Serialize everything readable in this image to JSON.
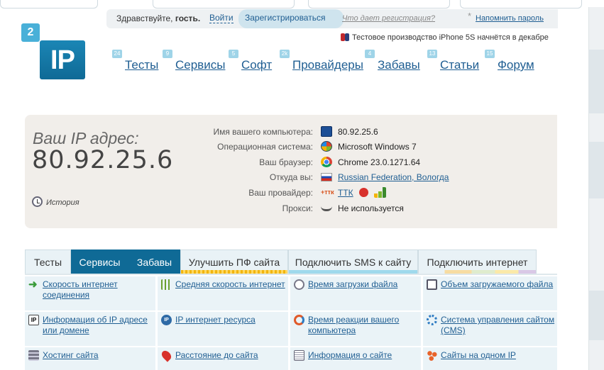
{
  "auth": {
    "hello_prefix": "Здравствуйте,",
    "hello_user": "гость.",
    "login": "Войти",
    "register": "Зарегистрироваться",
    "what_register": "Что дает регистрация?",
    "star": "*",
    "remind_password": "Напомнить пароль"
  },
  "news": {
    "text": "Тестовое производство iPhone 5S начнётся в декабре"
  },
  "logo": {
    "small": "2",
    "main": "IP"
  },
  "nav": [
    {
      "count": "24",
      "label": "Тесты"
    },
    {
      "count": "9",
      "label": "Сервисы"
    },
    {
      "count": "5",
      "label": "Софт"
    },
    {
      "count": "2k",
      "label": "Провайдеры"
    },
    {
      "count": "4",
      "label": "Забавы"
    },
    {
      "count": "13",
      "label": "Статьи"
    },
    {
      "count": "15",
      "label": "Форум"
    }
  ],
  "ip": {
    "heading": "Ваш IP адрес:",
    "value": "80.92.25.6",
    "history": "История"
  },
  "info": [
    {
      "label": "Имя вашего компьютера:",
      "icon": "computer-icon",
      "value": "80.92.25.6",
      "link": false
    },
    {
      "label": "Операционная система:",
      "icon": "windows-icon",
      "value": "Microsoft Windows 7",
      "link": false
    },
    {
      "label": "Ваш браузер:",
      "icon": "chrome-icon",
      "value": "Chrome 23.0.1271.64",
      "link": false
    },
    {
      "label": "Откуда вы:",
      "icon": "russia-flag-icon",
      "value": "Russian Federation, Вологда",
      "link": true
    },
    {
      "label": "Ваш провайдер:",
      "icon": "ttk-logo-icon",
      "value": "ТТК",
      "link": true
    },
    {
      "label": "Прокси:",
      "icon": "glasses-icon",
      "value": "Не используется",
      "link": false
    }
  ],
  "tabs": [
    {
      "label": "Тесты"
    },
    {
      "label": "Сервисы"
    },
    {
      "label": "Забавы"
    },
    {
      "label": "Улучшить ПФ сайта"
    },
    {
      "label": "Подключить SMS к сайту"
    },
    {
      "label": "Подключить интернет"
    }
  ],
  "services": [
    {
      "label": "Скорость интернет соединения",
      "icon": "speed-arrow-icon"
    },
    {
      "label": "Средняя скорость интернет",
      "icon": "bars-icon"
    },
    {
      "label": "Время загрузки файла",
      "icon": "clock-icon"
    },
    {
      "label": "Объем загружаемого файла",
      "icon": "file-size-icon"
    },
    {
      "label": "Информация об IP адресе или домене",
      "icon": "ip-box-icon",
      "icon_text": "IP"
    },
    {
      "label": "IP интернет ресурса",
      "icon": "ip-circle-icon",
      "icon_text": "IP"
    },
    {
      "label": "Время реакции вашего компьютера",
      "icon": "refresh-icon"
    },
    {
      "label": "Система управления сайтом (CMS)",
      "icon": "gears-icon"
    },
    {
      "label": "Хостинг сайта",
      "icon": "server-icon"
    },
    {
      "label": "Расстояние до сайта",
      "icon": "map-pin-icon"
    },
    {
      "label": "Информация о сайте",
      "icon": "document-icon"
    },
    {
      "label": "Сайты на одном IP",
      "icon": "cluster-icon"
    }
  ],
  "colors": {
    "accent": "#0f6a96",
    "link": "#1f5e92",
    "panel_bg": "#f1eeea",
    "cell_bg": "#eaf3f7"
  }
}
